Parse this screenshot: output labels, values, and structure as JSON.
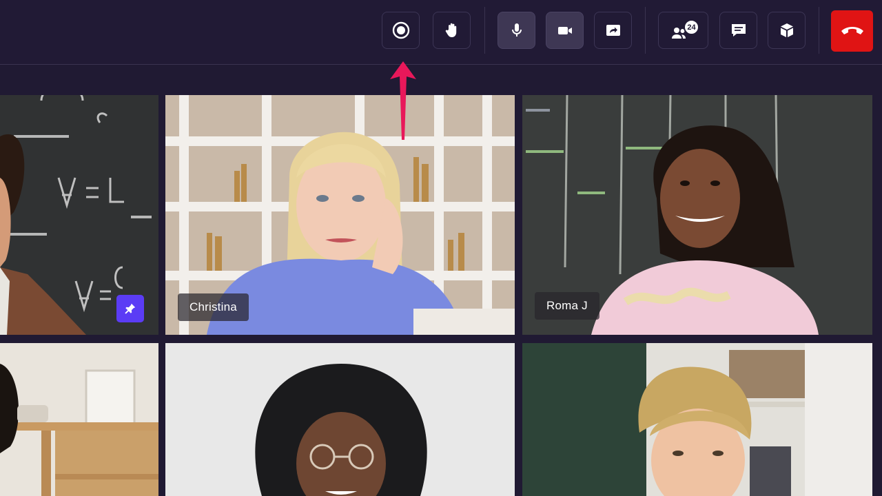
{
  "toolbar": {
    "buttons": [
      {
        "id": "record",
        "icon": "record-icon"
      },
      {
        "id": "raise-hand",
        "icon": "hand-icon"
      },
      {
        "id": "mic",
        "icon": "microphone-icon",
        "active": true
      },
      {
        "id": "camera",
        "icon": "video-camera-icon",
        "active": true
      },
      {
        "id": "share-screen",
        "icon": "screen-share-icon"
      },
      {
        "id": "participants",
        "icon": "participants-icon",
        "badge": "24"
      },
      {
        "id": "chat",
        "icon": "chat-icon"
      },
      {
        "id": "apps",
        "icon": "cube-icon"
      },
      {
        "id": "end-call",
        "icon": "phone-hangup-icon"
      }
    ],
    "colors": {
      "end_call": "#e01414",
      "pin": "#5b3cf5",
      "annotation_arrow": "#e8185a"
    }
  },
  "participants": [
    {
      "name": "",
      "pinned": true
    },
    {
      "name": "Christina"
    },
    {
      "name": "Roma J"
    },
    {
      "name": ""
    },
    {
      "name": ""
    },
    {
      "name": ""
    }
  ]
}
